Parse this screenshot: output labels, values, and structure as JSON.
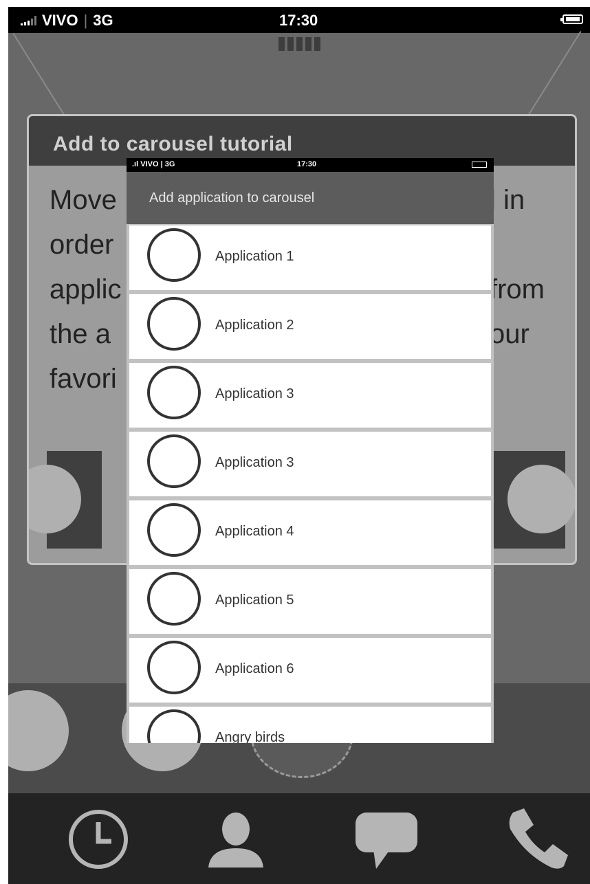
{
  "status_bar": {
    "carrier": "VIVO",
    "network": "3G",
    "time": "17:30"
  },
  "tutorial": {
    "title": "Add to carousel tutorial",
    "lines": [
      "Move",
      "order",
      "applic",
      "the a",
      "favori"
    ],
    "right_fragments": [
      "l in",
      "from",
      "our"
    ]
  },
  "modal": {
    "status_bar": {
      "carrier": "VIVO",
      "network": "3G",
      "time": "17:30"
    },
    "title": "Add application to carousel",
    "items": [
      {
        "label": "Application 1"
      },
      {
        "label": "Application 2"
      },
      {
        "label": "Application 3"
      },
      {
        "label": "Application 3"
      },
      {
        "label": "Application 4"
      },
      {
        "label": "Application 5"
      },
      {
        "label": "Application 6"
      },
      {
        "label": "Angry birds"
      }
    ]
  },
  "tabbar": {
    "items": [
      {
        "icon": "clock-icon"
      },
      {
        "icon": "contacts-icon"
      },
      {
        "icon": "chat-icon"
      },
      {
        "icon": "phone-icon"
      }
    ]
  }
}
